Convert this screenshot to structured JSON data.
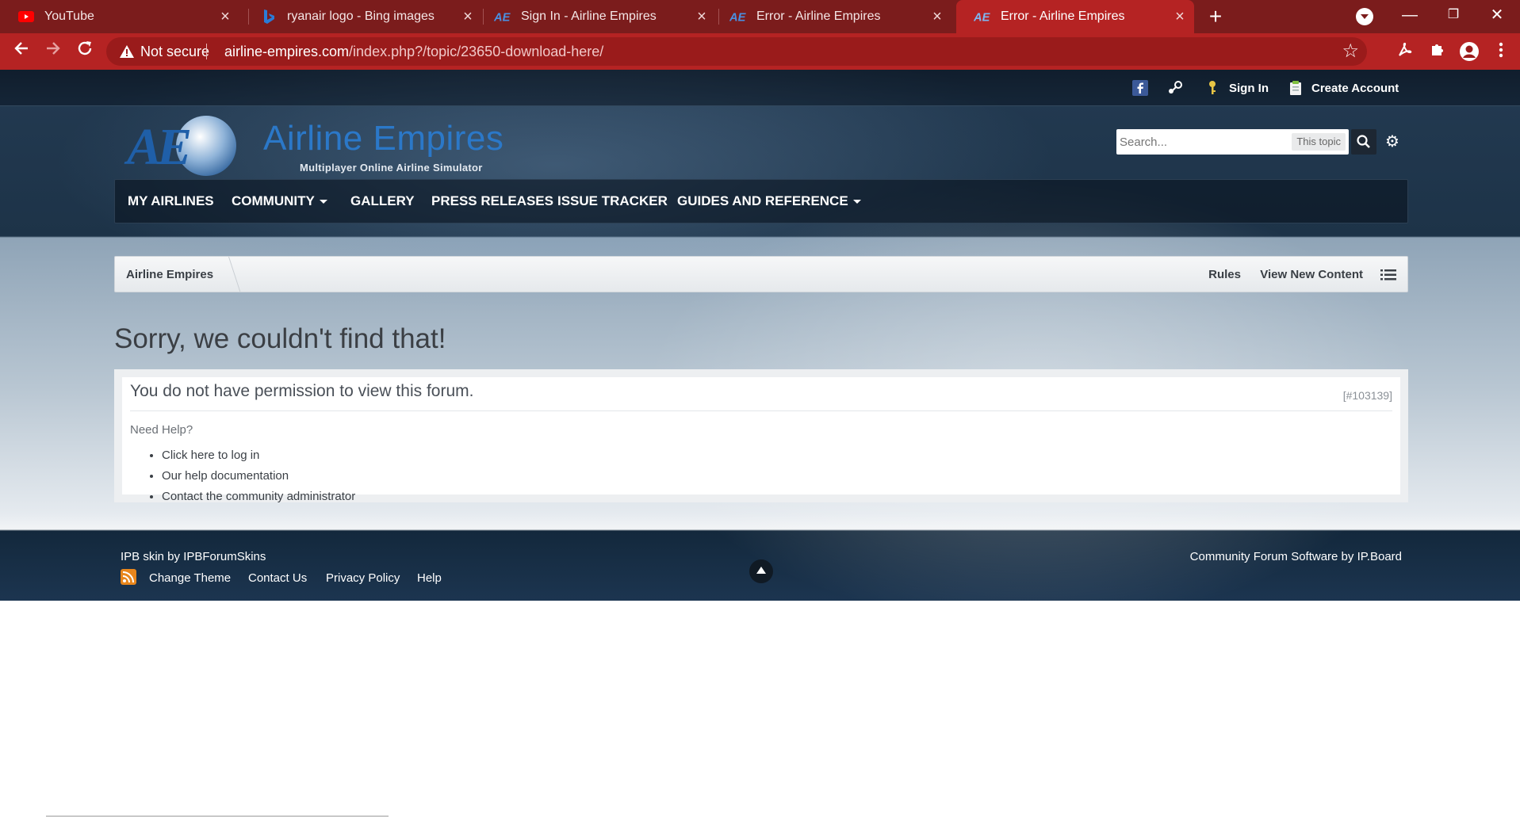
{
  "browser": {
    "tabs": [
      {
        "title": "YouTube",
        "close": "×"
      },
      {
        "title": "ryanair logo - Bing images",
        "close": "×"
      },
      {
        "title": "Sign In - Airline Empires",
        "close": "×"
      },
      {
        "title": "Error - Airline Empires",
        "close": "×"
      },
      {
        "title": "Error - Airline Empires",
        "close": "×",
        "active": true
      }
    ],
    "new_tab": "+",
    "window_controls": {
      "minimize": "—",
      "restore": "❐",
      "close": "✕"
    },
    "security_label": "Not secure",
    "url_host": "airline-empires.com",
    "url_path": "/index.php?/topic/23650-download-here/",
    "accent_color": "#b52323",
    "tabstrip_color": "#7b1c1c"
  },
  "site": {
    "userbar": {
      "sign_in": "Sign In",
      "create_account": "Create Account"
    },
    "logo": {
      "mark": "AE",
      "name": "Airline Empires",
      "tagline": "Multiplayer Online Airline Simulator"
    },
    "search": {
      "placeholder": "Search...",
      "scope": "This topic"
    },
    "nav": [
      {
        "label": "MY AIRLINES",
        "dropdown": false
      },
      {
        "label": "COMMUNITY",
        "dropdown": true
      },
      {
        "label": "GALLERY",
        "dropdown": false
      },
      {
        "label": "PRESS RELEASES",
        "dropdown": false
      },
      {
        "label": "ISSUE TRACKER",
        "dropdown": false
      },
      {
        "label": "GUIDES AND REFERENCE",
        "dropdown": true
      }
    ],
    "breadcrumb": {
      "home": "Airline Empires",
      "rules": "Rules",
      "view_new": "View New Content"
    },
    "error": {
      "title": "Sorry, we couldn't find that!",
      "message": "You do not have permission to view this forum.",
      "code": "[#103139]",
      "need_help": "Need Help?",
      "help_links": [
        "Click here to log in",
        "Our help documentation",
        "Contact the community administrator"
      ]
    },
    "footer": {
      "skin_credit": "IPB skin by IPBForumSkins",
      "links": [
        "Change Theme",
        "Contact Us",
        "Privacy Policy",
        "Help"
      ],
      "software_credit": "Community Forum Software by IP.Board"
    }
  }
}
